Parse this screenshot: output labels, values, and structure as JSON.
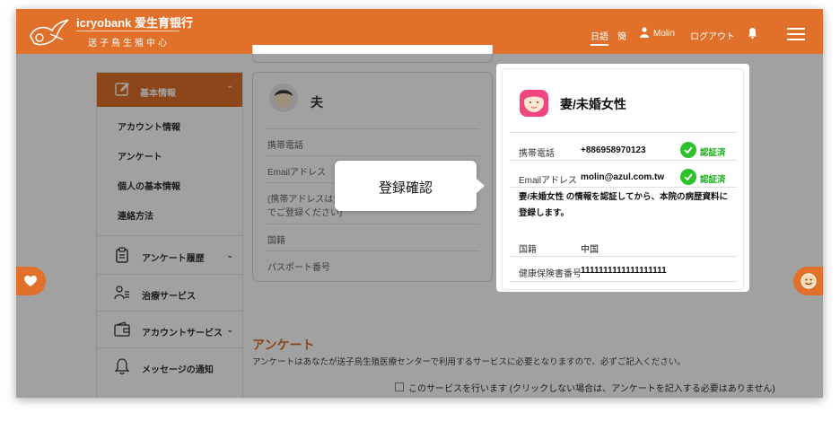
{
  "header": {
    "brand": "icryobank 爱生育银行",
    "subbrand": "送子鳥生殖中心",
    "nav": {
      "lang_jp": "日語",
      "lang_cn": "簡",
      "user": "Molin",
      "logout": "ログアウト"
    }
  },
  "sidebar": {
    "active_label": "基本情報",
    "sub_items": [
      "アカウント情報",
      "アンケート",
      "個人の基本情報",
      "連絡方法"
    ],
    "items": [
      {
        "label": "アンケート履歴",
        "icon": "clipboard-icon"
      },
      {
        "label": "治療サービス",
        "icon": "person-list-icon"
      },
      {
        "label": "アカウントサービス",
        "icon": "wallet-icon"
      },
      {
        "label": "メッセージの通知",
        "icon": "bell-icon"
      }
    ]
  },
  "form_card": {
    "name": "夫",
    "rows": [
      "携帯電話",
      "Emailアドレス",
      "(携帯アドレスは免",
      "でご登録ください)",
      "国籍",
      "パスポート番号"
    ]
  },
  "section": {
    "title": "アンケート",
    "description": "アンケートはあなたが送子鳥生殖医療センターで利用するサービスに必要となりますので、必ずご記入ください。",
    "checkbox_label": "このサービスを行います (クリックしない場合は、アンケートを記入する必要はありません)"
  },
  "tooltip": {
    "text": "登録確認"
  },
  "profile_card": {
    "name": "妻/未婚女性",
    "phone_label": "携帯電話",
    "phone_value": "+886958970123",
    "email_label": "Emailアドレス",
    "email_value": "molin@azul.com.tw",
    "verified_label": "認証済",
    "note": "妻/未婚女性 の情報を認証してから、本院の病歴資料に登録します。",
    "nationality_label": "国籍",
    "nationality_value": "中国",
    "insurance_label": "健康保険書番号",
    "insurance_value": "1111111111111111111"
  },
  "colors": {
    "brand": "#e0702a",
    "verified": "#2cc22c",
    "avatar_female": "#f0457f"
  }
}
